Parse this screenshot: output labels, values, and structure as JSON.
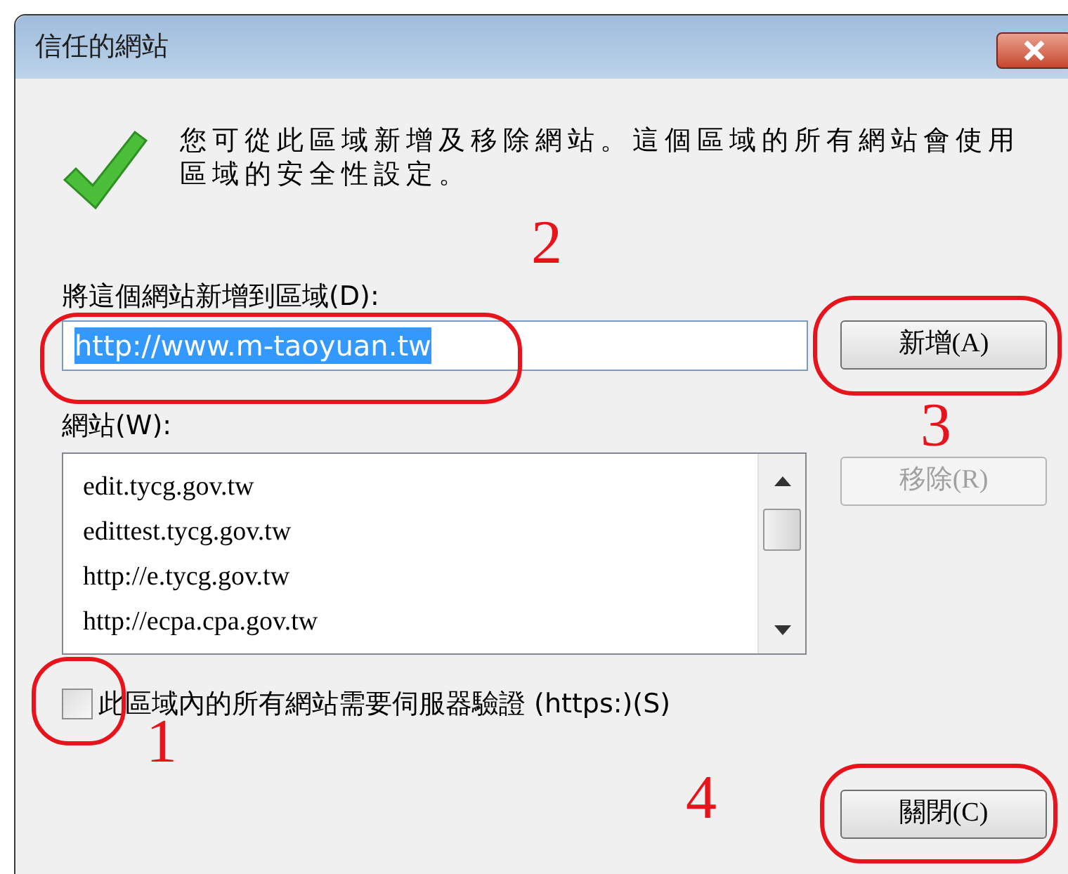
{
  "window": {
    "title": "信任的網站"
  },
  "description": "您可從此區域新增及移除網站。這個區域的所有網站會使用區域的安全性設定。",
  "add_field": {
    "label": "將這個網站新增到區域(D):",
    "value": "http://www.m-taoyuan.tw",
    "text_selected": true
  },
  "add_button": {
    "label": "新增(A)",
    "disabled": false
  },
  "sites": {
    "label": "網站(W):",
    "items": [
      {
        "text": "edit.tycg.gov.tw"
      },
      {
        "text": "edittest.tycg.gov.tw"
      },
      {
        "text": "http://e.tycg.gov.tw"
      },
      {
        "text": "http://ecpa.cpa.gov.tw"
      }
    ]
  },
  "remove_button": {
    "label": "移除(R)",
    "disabled": true
  },
  "https_checkbox": {
    "label": "此區域內的所有網站需要伺服器驗證 (https:)(S)",
    "checked": false
  },
  "close_button": {
    "label": "關閉(C)",
    "disabled": false
  },
  "annotations": [
    {
      "number": "2"
    },
    {
      "number": "3"
    },
    {
      "number": "1"
    },
    {
      "number": "4"
    }
  ]
}
